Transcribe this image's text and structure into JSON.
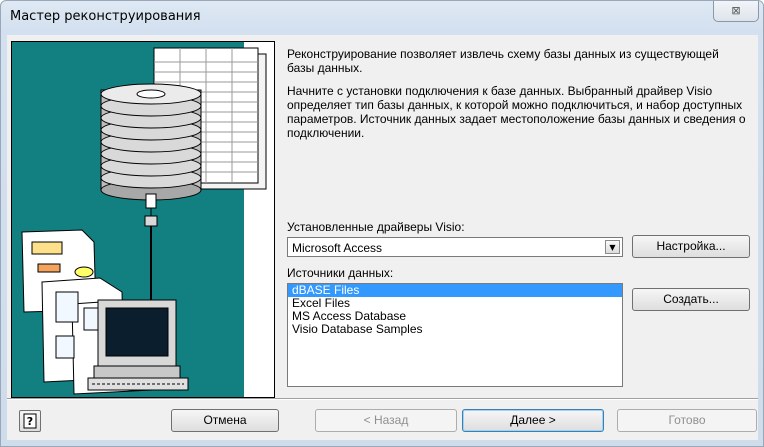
{
  "window": {
    "title": "Мастер реконструирования",
    "close_glyph": "⊠"
  },
  "intro": {
    "p1": "Реконструирование позволяет извлечь схему базы данных из существующей базы данных.",
    "p2": "Начните с установки подключения к базе данных.  Выбранный драйвер Visio определяет тип базы данных, к которой можно подключиться, и набор доступных параметров. Источник данных задает местоположение базы данных и сведения о подключении."
  },
  "drivers": {
    "label": "Установленные драйверы Visio:",
    "selected": "Microsoft Access",
    "settings_button": "Настройка..."
  },
  "sources": {
    "label": "Источники данных:",
    "items": [
      "dBASE Files",
      "Excel Files",
      "MS Access Database",
      "Visio Database Samples"
    ],
    "selected_index": 0,
    "create_button": "Создать..."
  },
  "footer": {
    "cancel": "Отмена",
    "back": "< Назад",
    "next": "Далее >",
    "finish": "Готово"
  },
  "colors": {
    "art_background": "#128080",
    "selection": "#3399ff"
  },
  "icons": {
    "help": "help-icon",
    "dropdown": "chevron-down-icon"
  }
}
